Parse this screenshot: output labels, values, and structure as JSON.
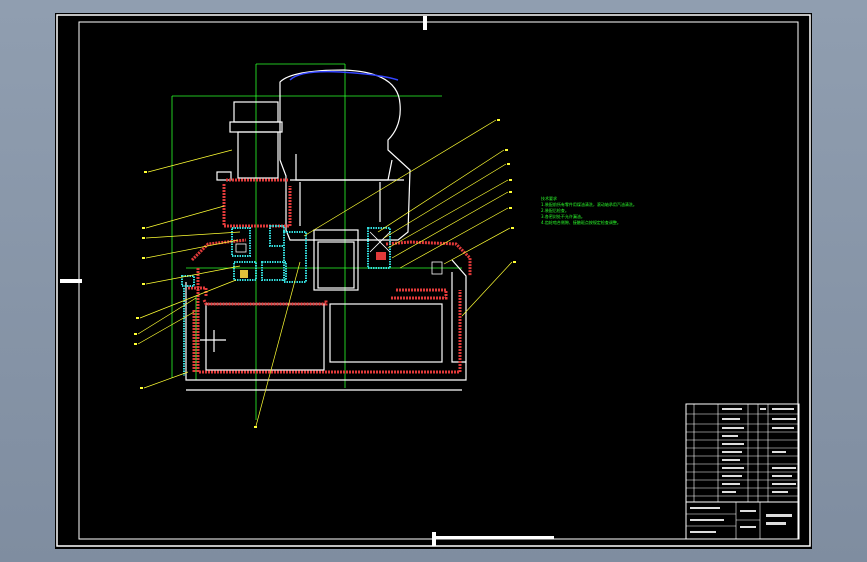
{
  "colors": {
    "background": "#8a98aa",
    "sheet": "#000000",
    "frame": "#ffffff",
    "centerline": "#2bff2b",
    "leader": "#ffff33",
    "hatch_red": "#e23a3a",
    "hatch_cyan": "#33dddd",
    "accent_blue": "#3344ff",
    "notes_text": "#2bff2b"
  },
  "drawing": {
    "technical_notes": [
      "技术要求",
      "1.装配前所有零件用煤油清洗，滚动轴承用汽油清洗。",
      "2.装配后检查。",
      "3.各密封处不允许漏油。",
      "4.齿轮啮合侧隙、接触斑点按规定检查调整。"
    ]
  },
  "title_block": {
    "rows": 14
  }
}
